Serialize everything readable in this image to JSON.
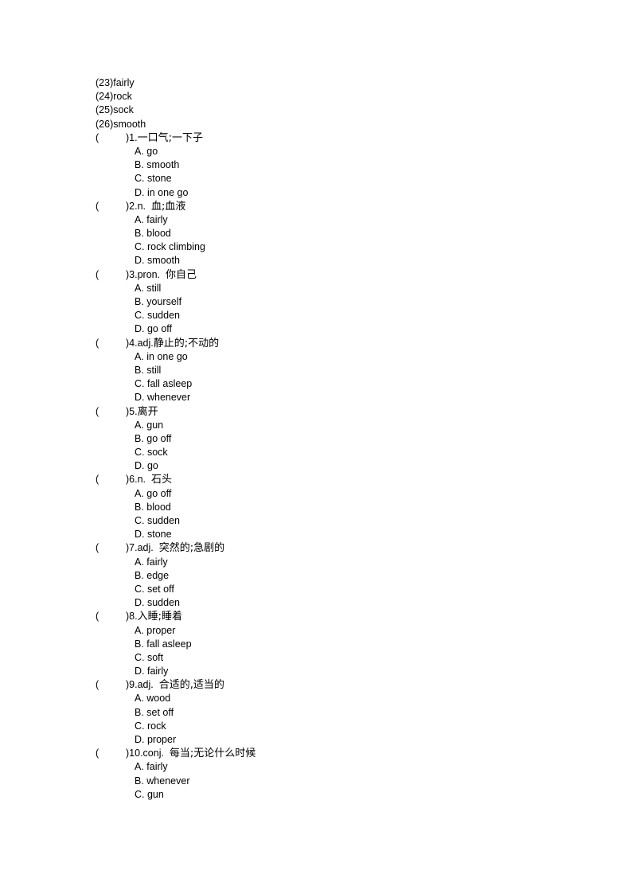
{
  "vocab": [
    "(23)fairly",
    "(24)rock",
    "(25)sock",
    "(26)smooth"
  ],
  "questions": [
    {
      "num": "1.",
      "prompt": "一口气;一下子",
      "options": [
        "A. go",
        "B. smooth",
        "C. stone",
        "D. in one go"
      ]
    },
    {
      "num": "2.n.  ",
      "prompt": "血;血液",
      "options": [
        "A. fairly",
        "B. blood",
        "C. rock climbing",
        "D. smooth"
      ]
    },
    {
      "num": "3.pron.  ",
      "prompt": "你自己",
      "options": [
        "A. still",
        "B. yourself",
        "C. sudden",
        "D. go off"
      ]
    },
    {
      "num": "4.adj.",
      "prompt": "静止的;不动的",
      "options": [
        "A. in one go",
        "B. still",
        "C. fall asleep",
        "D. whenever"
      ]
    },
    {
      "num": "5.",
      "prompt": "离开",
      "options": [
        "A. gun",
        "B. go off",
        "C. sock",
        "D. go"
      ]
    },
    {
      "num": "6.n.  ",
      "prompt": "石头",
      "options": [
        "A. go off",
        "B. blood",
        "C. sudden",
        "D. stone"
      ]
    },
    {
      "num": "7.adj.  ",
      "prompt": "突然的;急剧的",
      "options": [
        "A. fairly",
        "B. edge",
        "C. set off",
        "D. sudden"
      ]
    },
    {
      "num": "8.",
      "prompt": "入睡;睡着",
      "options": [
        "A. proper",
        "B. fall asleep",
        "C. soft",
        "D. fairly"
      ]
    },
    {
      "num": "9.adj.  ",
      "prompt": "合适的,适当的",
      "options": [
        "A. wood",
        "B. set off",
        "C. rock",
        "D. proper"
      ]
    },
    {
      "num": "10.conj.  ",
      "prompt": "每当;无论什么时候",
      "options": [
        "A. fairly",
        "B. whenever",
        "C. gun"
      ]
    }
  ],
  "bracket_open": "(",
  "bracket_close": ")"
}
